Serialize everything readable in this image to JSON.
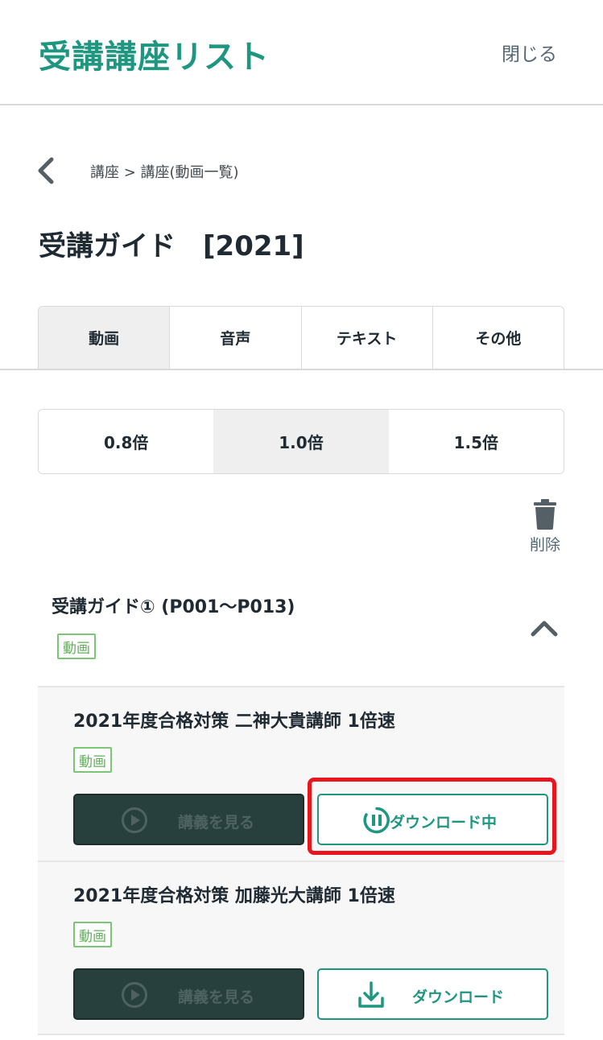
{
  "header": {
    "title": "受講講座リスト",
    "close_label": "閉じる"
  },
  "breadcrumb": {
    "text": "講座 > 講座(動画一覧)"
  },
  "page": {
    "title": "受講ガイド　[2021]"
  },
  "tabs": [
    {
      "label": "動画",
      "active": true
    },
    {
      "label": "音声",
      "active": false
    },
    {
      "label": "テキスト",
      "active": false
    },
    {
      "label": "その他",
      "active": false
    }
  ],
  "speeds": [
    {
      "label": "0.8倍",
      "active": false
    },
    {
      "label": "1.0倍",
      "active": true
    },
    {
      "label": "1.5倍",
      "active": false
    }
  ],
  "delete": {
    "label": "削除",
    "icon": "trash-icon"
  },
  "section": {
    "title": "受講ガイド① (P001〜P013)",
    "badge": "動画",
    "expanded": true
  },
  "lectures": [
    {
      "title": "2021年度合格対策 二神大貴講師 1倍速",
      "badge": "動画",
      "watch_label": "講義を見る",
      "download_label": "ダウンロード中",
      "download_state": "downloading"
    },
    {
      "title": "2021年度合格対策 加藤光大講師 1倍速",
      "badge": "動画",
      "watch_label": "講義を見る",
      "download_label": "ダウンロード",
      "download_state": "idle"
    }
  ],
  "colors": {
    "brand": "#1f9680",
    "badge": "#7cc576",
    "watch_bg": "#27403e",
    "highlight": "#e8141e"
  }
}
